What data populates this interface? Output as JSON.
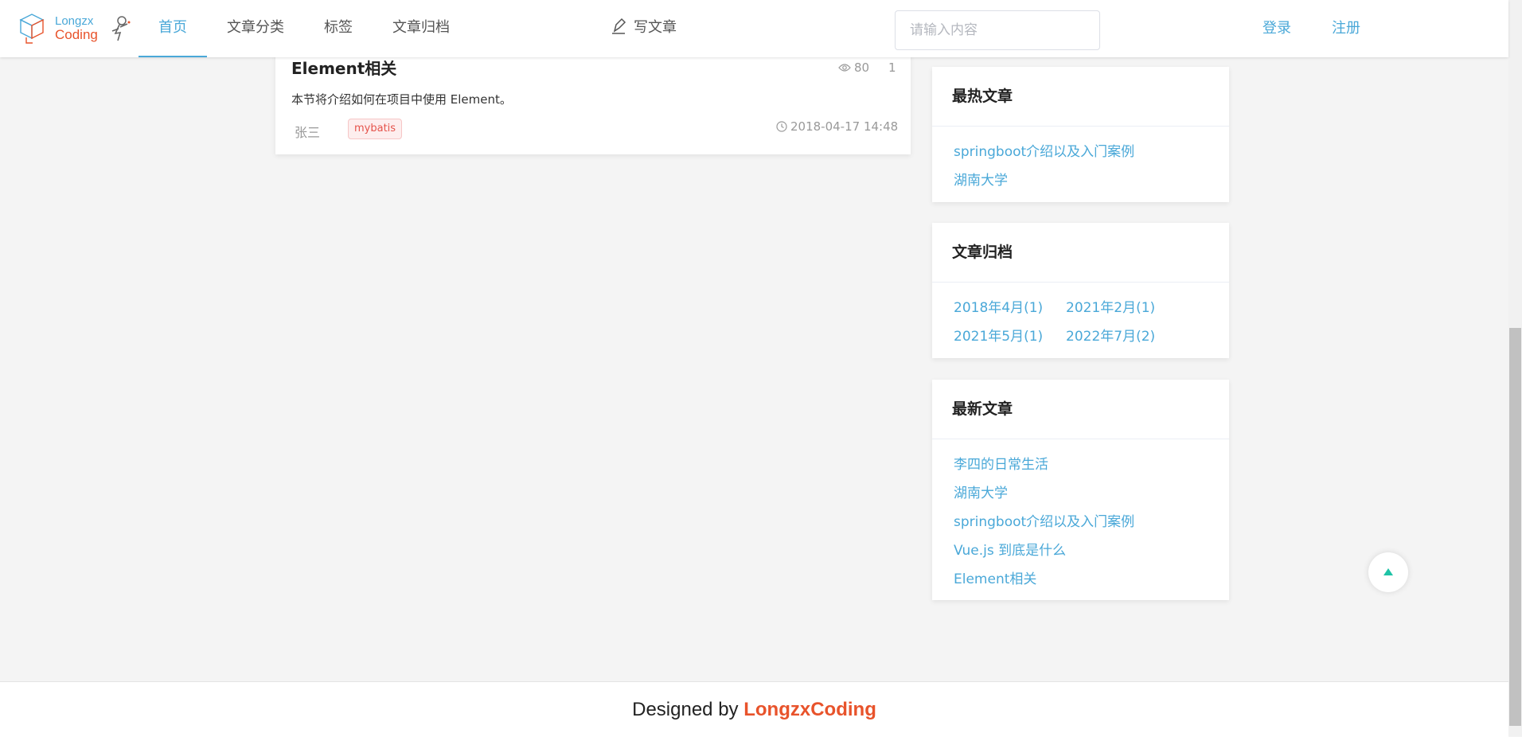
{
  "header": {
    "logo": {
      "line1": "Longzx",
      "line2": "Coding"
    },
    "nav": [
      {
        "label": "首页",
        "active": true
      },
      {
        "label": "文章分类",
        "active": false
      },
      {
        "label": "标签",
        "active": false
      },
      {
        "label": "文章归档",
        "active": false
      }
    ],
    "write_label": "写文章",
    "search_placeholder": "请输入内容",
    "login_label": "登录",
    "register_label": "注册"
  },
  "article": {
    "title": "Element相关",
    "views": "80",
    "comments": "1",
    "summary": "本节将介绍如何在项目中使用 Element。",
    "author": "张三",
    "tag": "mybatis",
    "date": "2018-04-17 14:48"
  },
  "hot_articles": {
    "title": "最热文章",
    "items": [
      "springboot介绍以及入门案例",
      "湖南大学"
    ]
  },
  "archives": {
    "title": "文章归档",
    "items": [
      "2018年4月(1)",
      "2021年2月(1)",
      "2021年5月(1)",
      "2022年7月(2)"
    ]
  },
  "new_articles": {
    "title": "最新文章",
    "items": [
      "李四的日常生活",
      "湖南大学",
      "springboot介绍以及入门案例",
      "Vue.js 到底是什么",
      "Element相关"
    ]
  },
  "footer": {
    "prefix": "Designed by ",
    "brand": "LongzxCoding"
  },
  "colors": {
    "accent": "#4aa8d8",
    "brand": "#e8532b",
    "tag": "#e5534b",
    "top_arrow": "#1fc3a6"
  },
  "icons": {
    "views": "eye-icon",
    "date": "clock-icon",
    "write": "pen-icon",
    "back_to_top": "caret-up-icon"
  }
}
